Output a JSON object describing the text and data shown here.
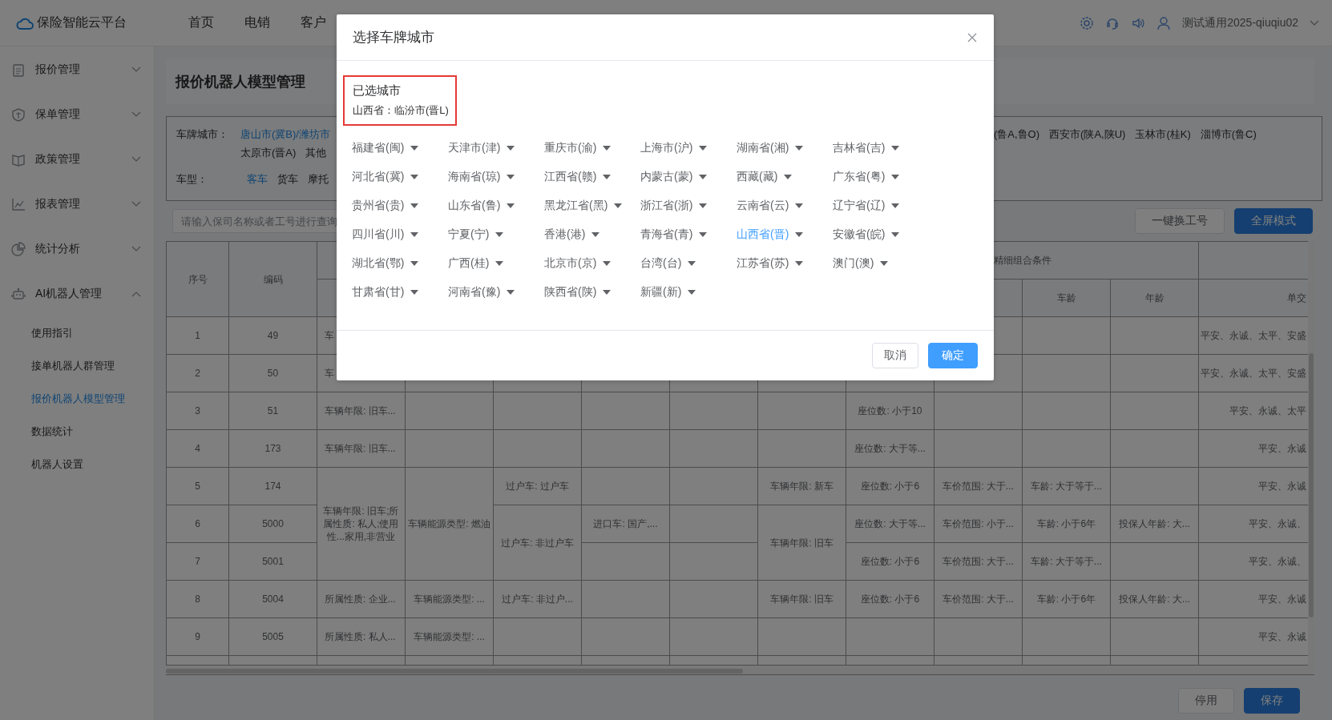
{
  "header": {
    "logo_text": "保险智能云平台",
    "nav": [
      {
        "label": "首页"
      },
      {
        "label": "电销"
      },
      {
        "label": "客户"
      }
    ],
    "username": "测试通用2025-qiuqiu02"
  },
  "sidebar": {
    "items": [
      {
        "label": "报价管理",
        "expanded": false
      },
      {
        "label": "保单管理",
        "expanded": false
      },
      {
        "label": "政策管理",
        "expanded": false
      },
      {
        "label": "报表管理",
        "expanded": false
      },
      {
        "label": "统计分析",
        "expanded": false
      },
      {
        "label": "AI机器人管理",
        "expanded": true,
        "children": [
          {
            "label": "使用指引",
            "selected": false
          },
          {
            "label": "接单机器人群管理",
            "selected": false
          },
          {
            "label": "报价机器人模型管理",
            "selected": true
          },
          {
            "label": "数据统计",
            "selected": false
          },
          {
            "label": "机器人设置",
            "selected": false
          }
        ]
      }
    ]
  },
  "page_title": "报价机器人模型管理",
  "filters": {
    "plate_city": {
      "label": "车牌城市：",
      "line_1": [
        {
          "text": "唐山市(冀B)/潍坊市",
          "selected": true
        }
      ],
      "line_2": [
        {
          "text": "太原市(晋A)",
          "selected": false
        },
        {
          "text": "其他",
          "selected": false
        }
      ],
      "right": [
        {
          "text": "(鲁A,鲁O)",
          "selected": false
        },
        {
          "text": "西安市(陕A,陕U)",
          "selected": false
        },
        {
          "text": "玉林市(桂K)",
          "selected": false
        },
        {
          "text": "淄博市(鲁C)",
          "selected": false
        }
      ]
    },
    "vehicle_type": {
      "label": "车型：",
      "values": [
        {
          "text": "客车",
          "selected": true
        },
        {
          "text": "货车",
          "selected": false
        },
        {
          "text": "摩托",
          "selected": false
        }
      ]
    }
  },
  "search": {
    "placeholder": "请输入保司名称或者工号进行查询"
  },
  "toolbar_buttons": [
    {
      "label": "一键换工号",
      "kind": "default"
    },
    {
      "label": "全屏模式",
      "kind": "primary"
    }
  ],
  "table": {
    "index_header": "序号",
    "code_header": "编码",
    "group_header": "精细组合条件",
    "sub_headers_right": [
      "车龄",
      "年龄",
      "单交"
    ],
    "rows": [
      {
        "index": "1",
        "code": "49",
        "cells": [
          "车",
          null,
          null,
          null,
          null,
          null,
          null,
          null,
          null,
          null,
          "平安、永诚、太平、安盛"
        ]
      },
      {
        "index": "2",
        "code": "50",
        "cells": [
          "车",
          null,
          null,
          null,
          null,
          null,
          null,
          null,
          null,
          null,
          "平安、永诚、太平、安盛"
        ]
      },
      {
        "index": "3",
        "code": "51",
        "cells": [
          "车辆年限: 旧车...",
          null,
          null,
          null,
          null,
          null,
          "座位数: 小于10",
          null,
          null,
          null,
          "平安、永诚、太平"
        ]
      },
      {
        "index": "4",
        "code": "173",
        "cells": [
          "车辆年限: 旧车...",
          null,
          null,
          null,
          null,
          null,
          "座位数: 大于等...",
          null,
          null,
          null,
          "平安、永诚"
        ]
      },
      {
        "index": "5",
        "code": "174",
        "cells": [
          {
            "text": "车辆年限: 旧车;所属性质: 私人;使用性...家用,非营业",
            "rowspan": 3
          },
          {
            "text": "车辆能源类型: 燃油",
            "rowspan": 3
          },
          "过户车: 过户车",
          null,
          null,
          "车辆年限: 新车",
          "座位数: 小于6",
          "车价范围: 大于...",
          "车龄: 大于等于...",
          null,
          "平安、永诚"
        ]
      },
      {
        "index": "6",
        "code": "5000",
        "cells": [
          {
            "text": "过户车: 非过户车",
            "rowspan": 2
          },
          "进口车: 国产,...",
          null,
          {
            "text": "车辆年限: 旧车",
            "rowspan": 2
          },
          "座位数: 大于等...",
          "车价范围: 小于...",
          "车龄: 小于6年",
          "投保人年龄: 大...",
          "平安、永诚、"
        ]
      },
      {
        "index": "7",
        "code": "5001",
        "cells": [
          null,
          null,
          "座位数: 小于6",
          "车价范围: 大于...",
          "车龄: 大于等于...",
          null,
          "平安、永诚、"
        ]
      },
      {
        "index": "8",
        "code": "5004",
        "cells": [
          "所属性质: 企业...",
          "车辆能源类型: ...",
          "过户车: 非过户...",
          null,
          null,
          "车辆年限: 旧车",
          "座位数: 小于6",
          "车价范围: 大于...",
          "车龄: 小于6年",
          "投保人年龄: 大...",
          "平安、永诚"
        ]
      },
      {
        "index": "9",
        "code": "5005",
        "cells": [
          "所属性质: 私人...",
          "车辆能源类型: ...",
          null,
          null,
          null,
          null,
          null,
          null,
          null,
          null,
          "平安、永诚"
        ]
      }
    ]
  },
  "footer_buttons": [
    {
      "label": "停用",
      "kind": "default"
    },
    {
      "label": "保存",
      "kind": "primary"
    }
  ],
  "dialog": {
    "title": "选择车牌城市",
    "selected_heading": "已选城市",
    "selected_text": "山西省：临汾市(晋L)",
    "provinces": [
      {
        "label": "福建省(闽)",
        "selected": false
      },
      {
        "label": "天津市(津)",
        "selected": false
      },
      {
        "label": "重庆市(渝)",
        "selected": false
      },
      {
        "label": "上海市(沪)",
        "selected": false
      },
      {
        "label": "湖南省(湘)",
        "selected": false
      },
      {
        "label": "吉林省(吉)",
        "selected": false
      },
      {
        "label": "河北省(冀)",
        "selected": false
      },
      {
        "label": "海南省(琼)",
        "selected": false
      },
      {
        "label": "江西省(赣)",
        "selected": false
      },
      {
        "label": "内蒙古(蒙)",
        "selected": false
      },
      {
        "label": "西藏(藏)",
        "selected": false
      },
      {
        "label": "广东省(粤)",
        "selected": false
      },
      {
        "label": "贵州省(贵)",
        "selected": false
      },
      {
        "label": "山东省(鲁)",
        "selected": false
      },
      {
        "label": "黑龙江省(黑)",
        "selected": false
      },
      {
        "label": "浙江省(浙)",
        "selected": false
      },
      {
        "label": "云南省(云)",
        "selected": false
      },
      {
        "label": "辽宁省(辽)",
        "selected": false
      },
      {
        "label": "四川省(川)",
        "selected": false
      },
      {
        "label": "宁夏(宁)",
        "selected": false
      },
      {
        "label": "香港(港)",
        "selected": false
      },
      {
        "label": "青海省(青)",
        "selected": false
      },
      {
        "label": "山西省(晋)",
        "selected": true
      },
      {
        "label": "安徽省(皖)",
        "selected": false
      },
      {
        "label": "湖北省(鄂)",
        "selected": false
      },
      {
        "label": "广西(桂)",
        "selected": false
      },
      {
        "label": "北京市(京)",
        "selected": false
      },
      {
        "label": "台湾(台)",
        "selected": false
      },
      {
        "label": "江苏省(苏)",
        "selected": false
      },
      {
        "label": "澳门(澳)",
        "selected": false
      },
      {
        "label": "甘肃省(甘)",
        "selected": false
      },
      {
        "label": "河南省(豫)",
        "selected": false
      },
      {
        "label": "陕西省(陕)",
        "selected": false
      },
      {
        "label": "新疆(新)",
        "selected": false
      }
    ],
    "buttons": [
      {
        "label": "取消",
        "kind": "default"
      },
      {
        "label": "确定",
        "kind": "primary"
      }
    ]
  }
}
